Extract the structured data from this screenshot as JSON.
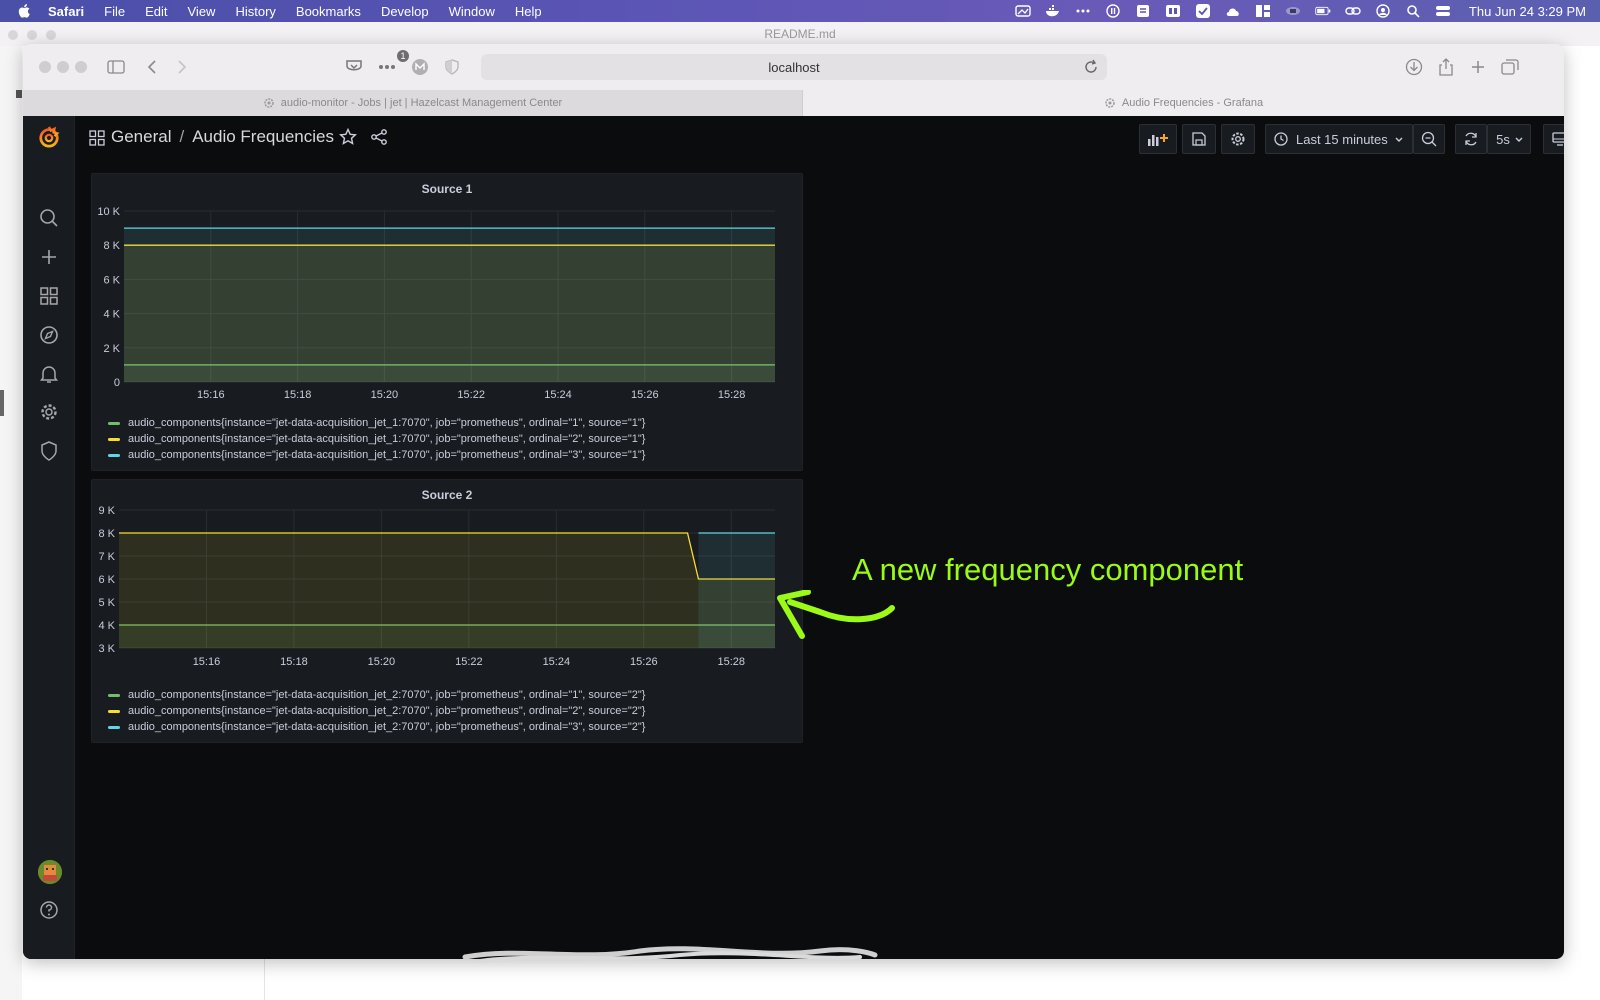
{
  "menubar": {
    "app": "Safari",
    "items": [
      "File",
      "Edit",
      "View",
      "History",
      "Bookmarks",
      "Develop",
      "Window",
      "Help"
    ],
    "clock": "Thu Jun 24  3:29 PM"
  },
  "background_window": {
    "title": "README.md"
  },
  "safari": {
    "url": "localhost",
    "badge": "1",
    "tabs": [
      {
        "label": "audio-monitor - Jobs | jet | Hazelcast Management Center",
        "active": false
      },
      {
        "label": "Audio Frequencies - Grafana",
        "active": true
      }
    ]
  },
  "grafana": {
    "breadcrumb": {
      "folder": "General",
      "separator": "/",
      "dashboard": "Audio Frequencies"
    },
    "time_range": "Last 15 minutes",
    "refresh": "5s"
  },
  "colors": {
    "green": "#73bf69",
    "yellow": "#fade2a",
    "cyan": "#5fd7e3",
    "annotation": "#9bfa16"
  },
  "chart_data": [
    {
      "type": "line",
      "title": "Source 1",
      "ylim": [
        0,
        10000
      ],
      "yticks": [
        "0",
        "2 K",
        "4 K",
        "6 K",
        "8 K",
        "10 K"
      ],
      "xticks": [
        "15:16",
        "15:18",
        "15:20",
        "15:22",
        "15:24",
        "15:26",
        "15:28"
      ],
      "x_range": [
        "15:14",
        "15:29"
      ],
      "grid": true,
      "series": [
        {
          "name": "audio_components{instance=\"jet-data-acquisition_jet_1:7070\", job=\"prometheus\", ordinal=\"1\", source=\"1\"}",
          "color": "#73bf69",
          "points": [
            [
              "15:14",
              1000
            ],
            [
              "15:29",
              1000
            ]
          ]
        },
        {
          "name": "audio_components{instance=\"jet-data-acquisition_jet_1:7070\", job=\"prometheus\", ordinal=\"2\", source=\"1\"}",
          "color": "#fade2a",
          "points": [
            [
              "15:14",
              8000
            ],
            [
              "15:29",
              8000
            ]
          ]
        },
        {
          "name": "audio_components{instance=\"jet-data-acquisition_jet_1:7070\", job=\"prometheus\", ordinal=\"3\", source=\"1\"}",
          "color": "#5fd7e3",
          "points": [
            [
              "15:14",
              9000
            ],
            [
              "15:29",
              9000
            ]
          ]
        }
      ]
    },
    {
      "type": "line",
      "title": "Source 2",
      "ylim": [
        3000,
        9000
      ],
      "yticks": [
        "3 K",
        "4 K",
        "5 K",
        "6 K",
        "7 K",
        "8 K",
        "9 K"
      ],
      "xticks": [
        "15:16",
        "15:18",
        "15:20",
        "15:22",
        "15:24",
        "15:26",
        "15:28"
      ],
      "x_range": [
        "15:14",
        "15:29"
      ],
      "grid": true,
      "series": [
        {
          "name": "audio_components{instance=\"jet-data-acquisition_jet_2:7070\", job=\"prometheus\", ordinal=\"1\", source=\"2\"}",
          "color": "#73bf69",
          "points": [
            [
              "15:14",
              4000
            ],
            [
              "15:29",
              4000
            ]
          ]
        },
        {
          "name": "audio_components{instance=\"jet-data-acquisition_jet_2:7070\", job=\"prometheus\", ordinal=\"2\", source=\"2\"}",
          "color": "#fade2a",
          "points": [
            [
              "15:14",
              8000
            ],
            [
              "15:27:00",
              8000
            ],
            [
              "15:27:15",
              6000
            ],
            [
              "15:29",
              6000
            ]
          ]
        },
        {
          "name": "audio_components{instance=\"jet-data-acquisition_jet_2:7070\", job=\"prometheus\", ordinal=\"3\", source=\"2\"}",
          "color": "#5fd7e3",
          "points": [
            [
              "15:27:15",
              8000
            ],
            [
              "15:29",
              8000
            ]
          ]
        }
      ]
    }
  ],
  "annotation": {
    "text": "A new frequency component"
  }
}
